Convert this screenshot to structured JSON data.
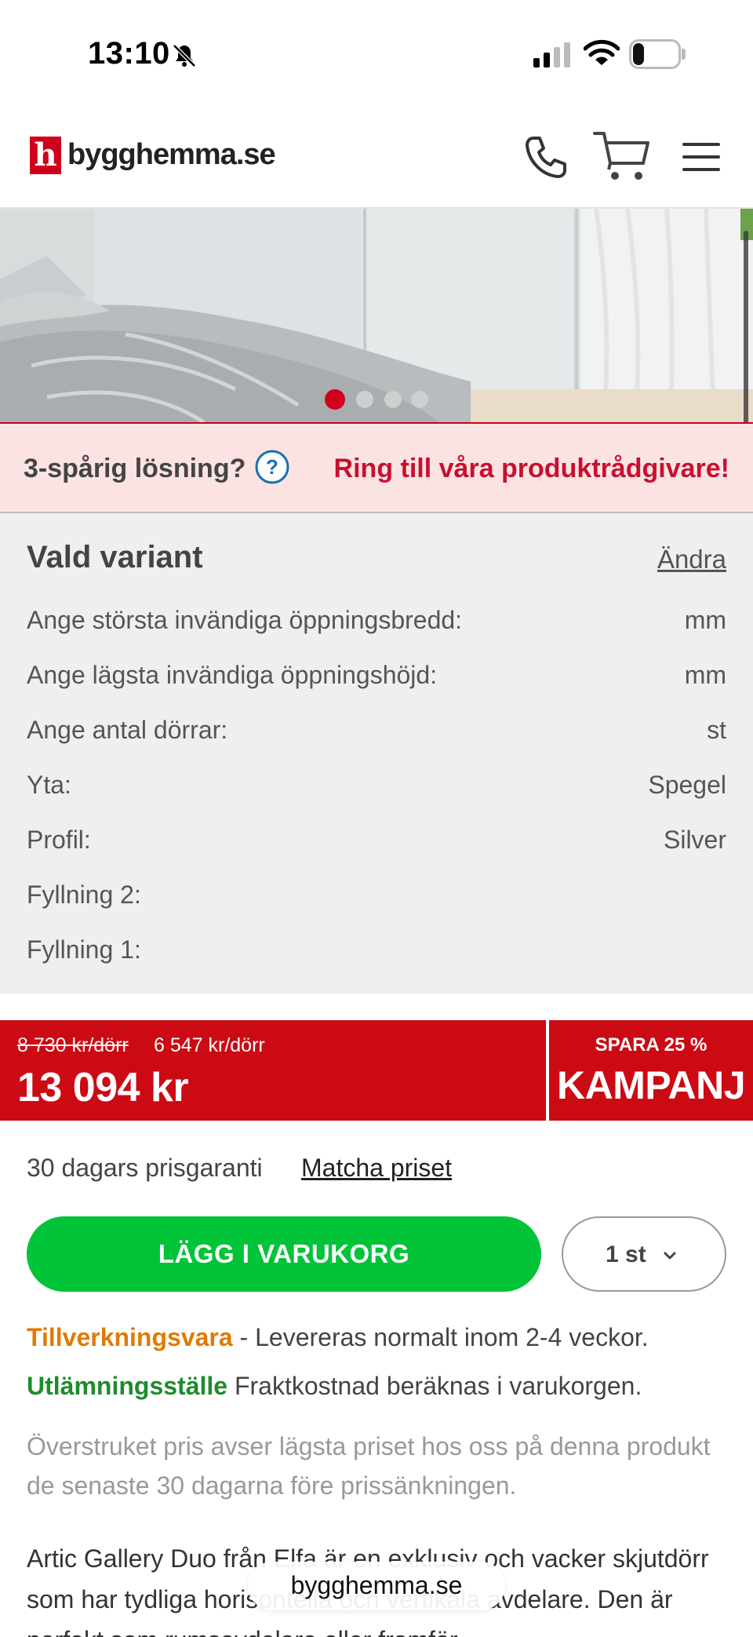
{
  "status_bar": {
    "time": "13:10",
    "battery": "25",
    "battery_level": 0.25
  },
  "header": {
    "logo_letter": "h",
    "logo_text": "bygghemma.se",
    "icons": [
      "phone-icon",
      "cart-icon",
      "menu-icon"
    ]
  },
  "hero": {
    "slide_count": 4,
    "active_slide": 1
  },
  "advisor": {
    "question": "3-spårig lösning?",
    "help_icon": "?",
    "link": "Ring till våra produktrådgivare!"
  },
  "variant": {
    "title": "Vald variant",
    "change": "Ändra",
    "rows": [
      {
        "label": "Ange största invändiga öppningsbredd:",
        "value": "mm"
      },
      {
        "label": "Ange lägsta invändiga öppningshöjd:",
        "value": "mm"
      },
      {
        "label": "Ange antal dörrar:",
        "value": "st"
      },
      {
        "label": "Yta:",
        "value": "Spegel"
      },
      {
        "label": "Profil:",
        "value": "Silver"
      },
      {
        "label": "Fyllning 2:",
        "value": ""
      },
      {
        "label": "Fyllning 1:",
        "value": ""
      }
    ]
  },
  "price": {
    "old_unit": "8 730 kr/dörr",
    "new_unit": "6 547 kr/dörr",
    "total": "13 094 kr",
    "save": "SPARA 25 %",
    "campaign": "KAMPANJ"
  },
  "guarantee": {
    "text": "30 dagars prisgaranti",
    "match": "Matcha priset"
  },
  "buttons": {
    "add_to_cart": "LÄGG I VARUKORG",
    "quantity": "1 st"
  },
  "delivery": {
    "label": "Tillverkningsvara",
    "text": " - Levereras normalt inom 2-4 veckor."
  },
  "pickup": {
    "label": "Utlämningsställe",
    "text": " Fraktkostnad beräknas i varukorgen."
  },
  "disclaimer": "Överstruket pris avser lägsta priset hos oss på denna produkt de senaste 30 dagarna före prissänkningen.",
  "description": "Artic Gallery Duo från Elfa är en exklusiv och vacker skjutdörr som har tydliga horisontella och vertikala avdelare. Den är perfekt som rumsavdelare eller framför",
  "url_bar": "bygghemma.se",
  "colors": {
    "brand_red": "#d0021b",
    "price_red": "#cc0a14",
    "cta_green": "#00c338",
    "orange": "#e07a00",
    "green_text": "#1e8c2a"
  }
}
